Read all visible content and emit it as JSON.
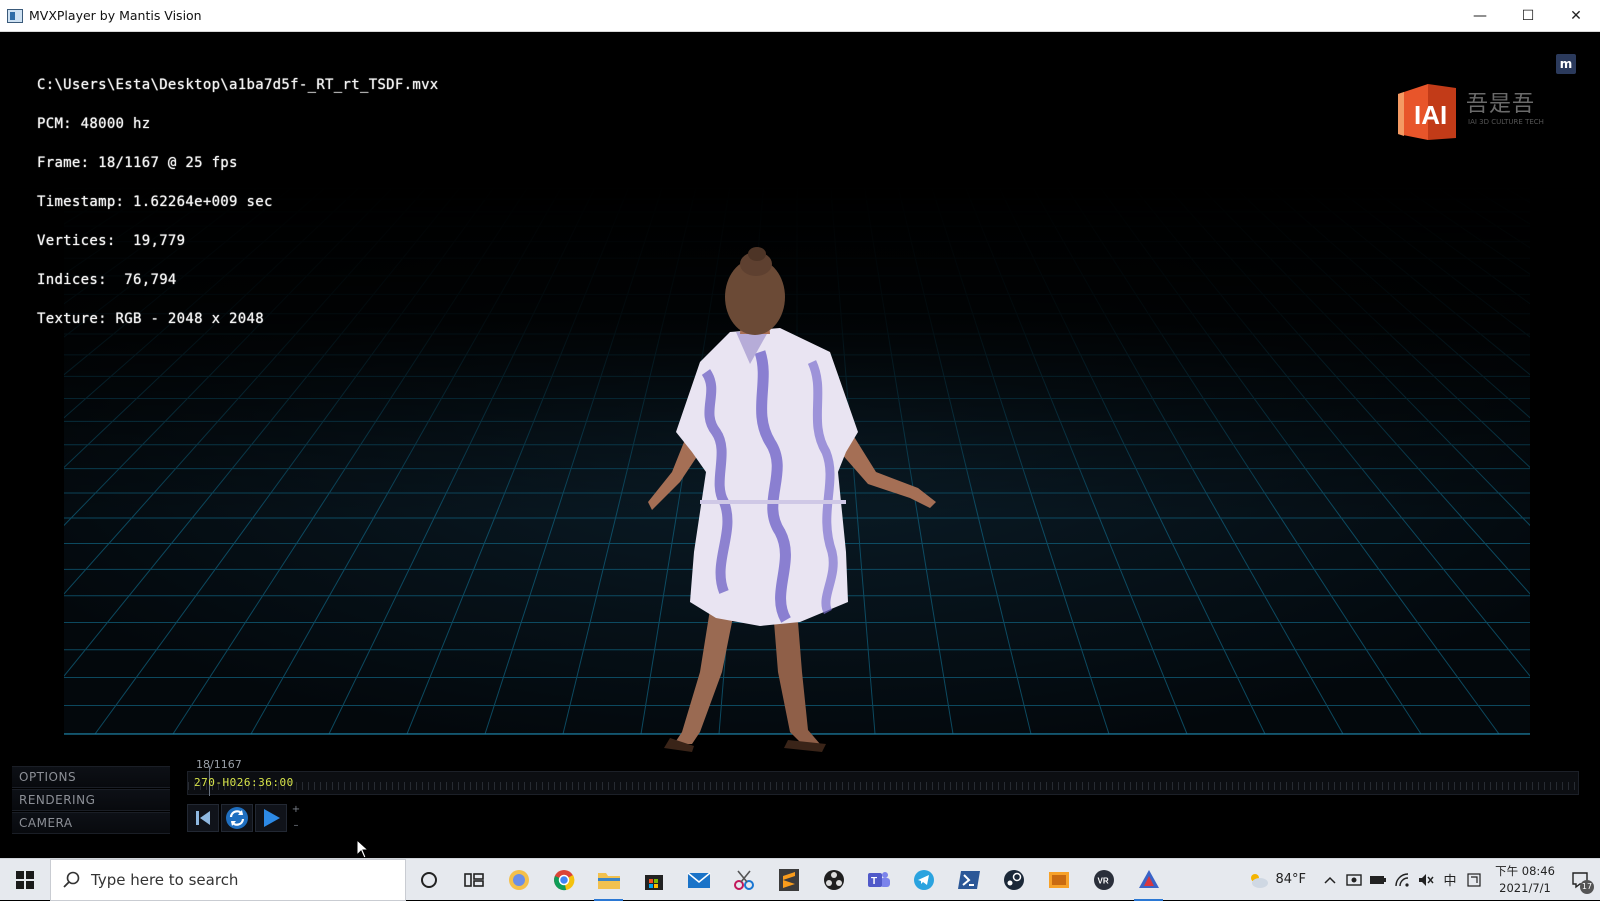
{
  "window": {
    "title": "MVXPlayer by Mantis Vision",
    "minimize_glyph": "—",
    "maximize_glyph": "☐",
    "close_glyph": "✕"
  },
  "overlay": {
    "lines": [
      "C:\\Users\\Esta\\Desktop\\a1ba7d5f-_RT_rt_TSDF.mvx",
      "PCM: 48000 hz",
      "Frame: 18/1167 @ 25 fps",
      "Timestamp: 1.62264e+009 sec",
      "Vertices:  19,779",
      "Indices:  76,794",
      "Texture: RGB - 2048 x 2048"
    ],
    "corner_badge": "m"
  },
  "brand": {
    "logo_text": "IAI",
    "name": "吾是吾",
    "subtitle": "IAI 3D CULTURE TECH"
  },
  "side_menu": {
    "items": [
      "OPTIONS",
      "RENDERING",
      "CAMERA"
    ]
  },
  "timeline": {
    "frame_counter": "18/1167",
    "timecode": "270-H026:36:00",
    "current_frame": 18,
    "total_frames": 1167
  },
  "controls": {
    "rewind_icon": "skip-back-icon",
    "loop_icon": "loop-icon",
    "play_icon": "play-icon",
    "step_up": "+",
    "step_down": "–"
  },
  "taskbar": {
    "search_placeholder": "Type here to search",
    "weather_temp": "84°F",
    "tray_lang": "中",
    "clock_time": "下午 08:46",
    "clock_date": "2021/7/1",
    "notifications_count": "17"
  },
  "colors": {
    "grid_line": "#0f5e7a",
    "timecode": "#d7e44a",
    "taskbar_bg": "#e6e9ee",
    "brand_orange": "#e8552a"
  }
}
